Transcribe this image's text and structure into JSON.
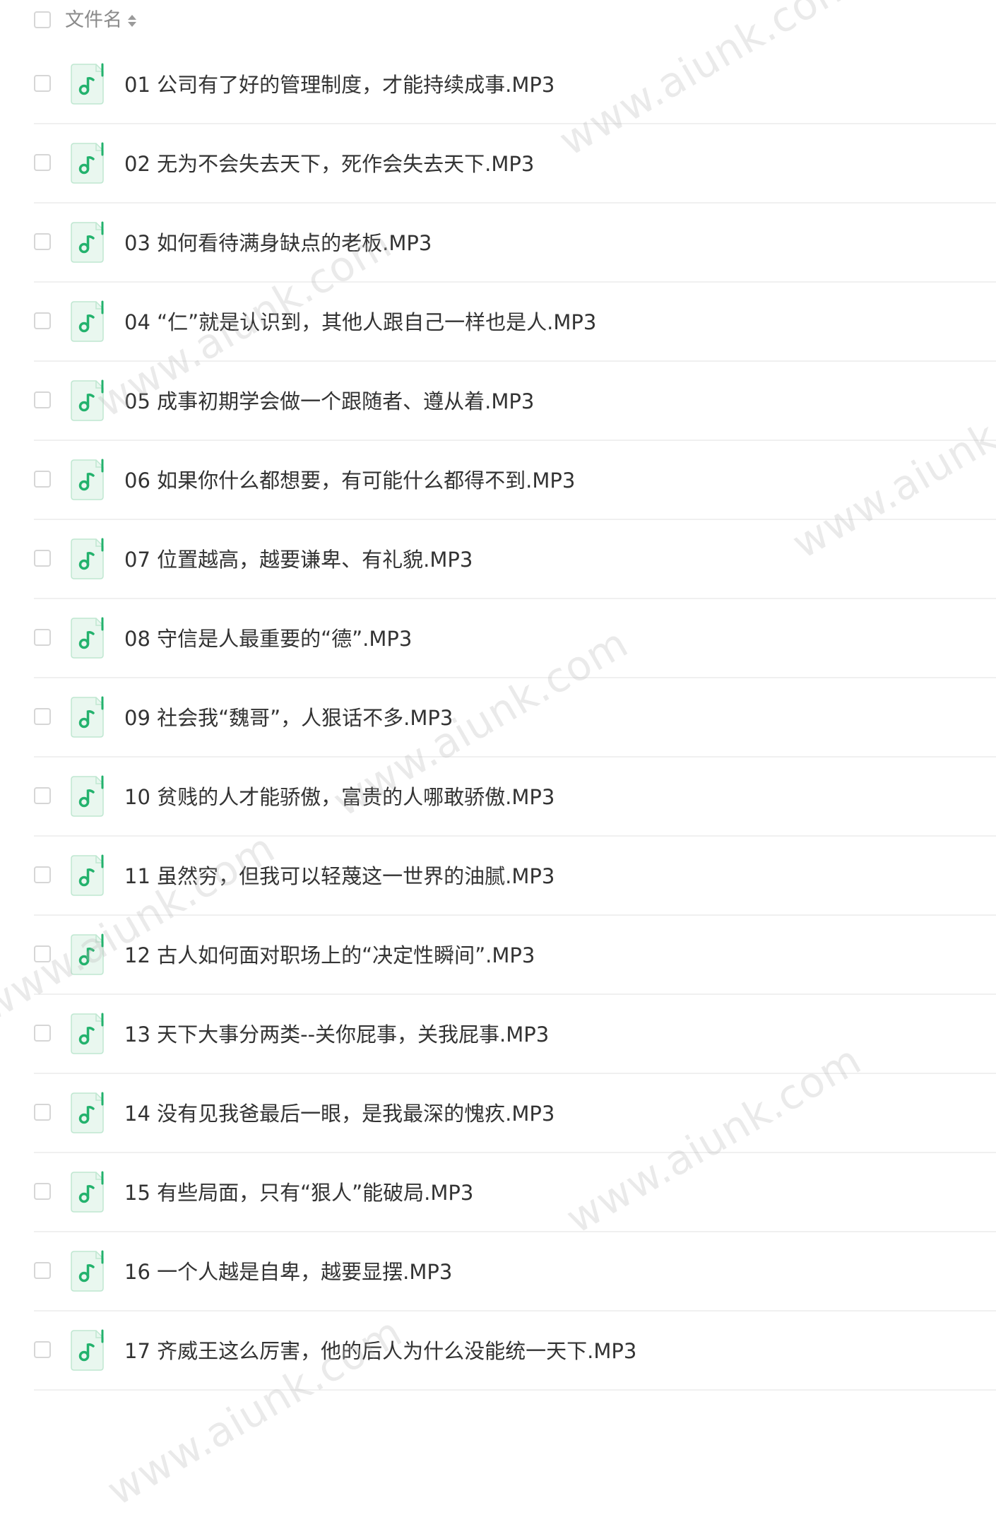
{
  "header": {
    "column_label": "文件名",
    "sort_icon": "sort-icon"
  },
  "files": [
    {
      "name": "01 公司有了好的管理制度，才能持续成事.MP3",
      "icon": "music-note-icon"
    },
    {
      "name": "02 无为不会失去天下，死作会失去天下.MP3",
      "icon": "music-note-icon"
    },
    {
      "name": "03 如何看待满身缺点的老板.MP3",
      "icon": "music-note-icon"
    },
    {
      "name": "04 “仁”就是认识到，其他人跟自己一样也是人.MP3",
      "icon": "music-note-icon"
    },
    {
      "name": "05 成事初期学会做一个跟随者、遵从着.MP3",
      "icon": "music-note-icon"
    },
    {
      "name": "06 如果你什么都想要，有可能什么都得不到.MP3",
      "icon": "music-note-icon"
    },
    {
      "name": "07 位置越高，越要谦卑、有礼貌.MP3",
      "icon": "music-note-icon"
    },
    {
      "name": "08 守信是人最重要的“德”.MP3",
      "icon": "music-note-icon"
    },
    {
      "name": "09 社会我“魏哥”，人狠话不多.MP3",
      "icon": "music-note-icon"
    },
    {
      "name": "10 贫贱的人才能骄傲，富贵的人哪敢骄傲.MP3",
      "icon": "music-note-icon"
    },
    {
      "name": "11 虽然穷，但我可以轻蔑这一世界的油腻.MP3",
      "icon": "music-note-icon"
    },
    {
      "name": "12 古人如何面对职场上的“决定性瞬间”.MP3",
      "icon": "music-note-icon"
    },
    {
      "name": "13 天下大事分两类--关你屁事，关我屁事.MP3",
      "icon": "music-note-icon"
    },
    {
      "name": "14 没有见我爸最后一眼，是我最深的愧疚.MP3",
      "icon": "music-note-icon"
    },
    {
      "name": "15 有些局面，只有“狠人”能破局.MP3",
      "icon": "music-note-icon"
    },
    {
      "name": "16 一个人越是自卑，越要显摆.MP3",
      "icon": "music-note-icon"
    },
    {
      "name": "17 齐威王这么厉害，他的后人为什么没能统一天下.MP3",
      "icon": "music-note-icon"
    }
  ],
  "watermark": {
    "text": "www.aiunk.com"
  },
  "colors": {
    "accent": "#23b26d",
    "icon_bg": "#e9f7ef",
    "text": "#333333",
    "header_text": "#8a8a8a",
    "divider": "#f0f0f0"
  }
}
